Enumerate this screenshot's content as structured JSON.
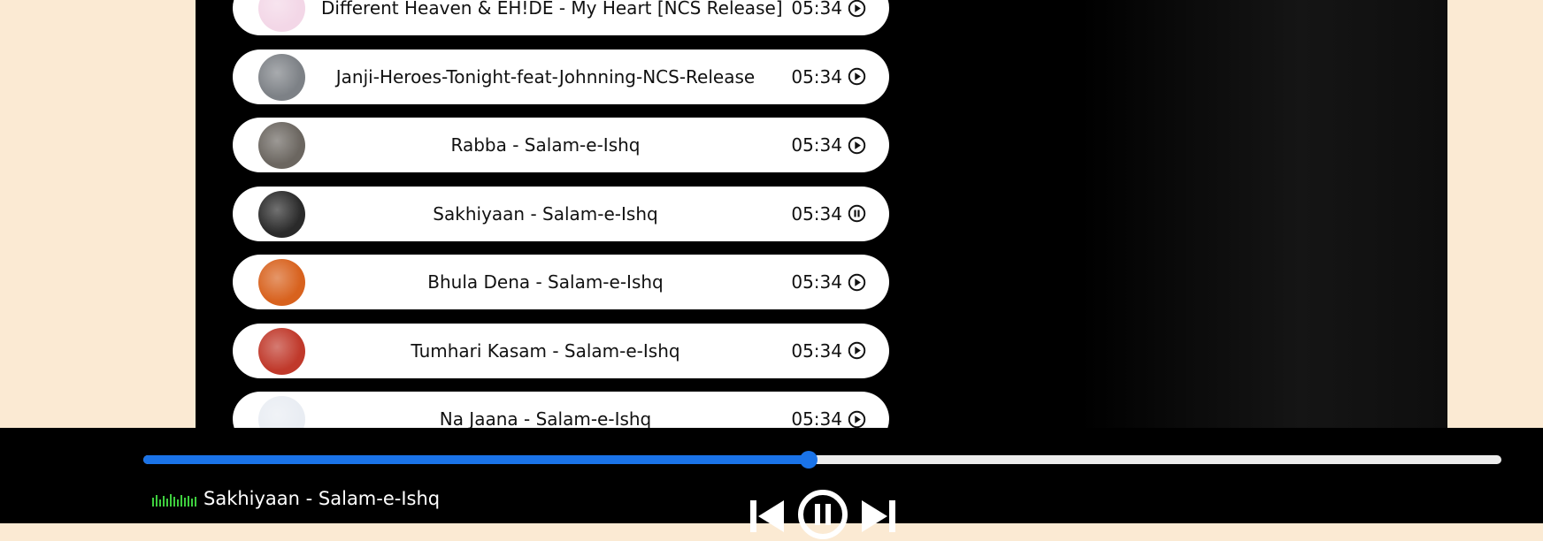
{
  "songs": [
    {
      "name": "Different Heaven & EH!DE - My Heart [NCS Release]",
      "time": "05:34",
      "state": "play-icon",
      "cover_color": "#f3d7e7"
    },
    {
      "name": "Janji-Heroes-Tonight-feat-Johnning-NCS-Release",
      "time": "05:34",
      "state": "play-icon",
      "cover_color": "#7d8186"
    },
    {
      "name": "Rabba - Salam-e-Ishq",
      "time": "05:34",
      "state": "play-icon",
      "cover_color": "#6b6660"
    },
    {
      "name": "Sakhiyaan - Salam-e-Ishq",
      "time": "05:34",
      "state": "pause-icon",
      "cover_color": "#2a2a2a"
    },
    {
      "name": "Bhula Dena - Salam-e-Ishq",
      "time": "05:34",
      "state": "play-icon",
      "cover_color": "#d8621e"
    },
    {
      "name": "Tumhari Kasam - Salam-e-Ishq",
      "time": "05:34",
      "state": "play-icon",
      "cover_color": "#c0392b"
    },
    {
      "name": "Na Jaana - Salam-e-Ishq",
      "time": "05:34",
      "state": "play-icon",
      "cover_color": "#e9edf3"
    }
  ],
  "player": {
    "now_playing": "Sakhiyaan - Salam-e-Ishq",
    "progress_fraction": 0.49,
    "accent_color": "#1a73e8",
    "controls": [
      "previous-icon",
      "pause-circle-icon",
      "next-icon"
    ]
  }
}
